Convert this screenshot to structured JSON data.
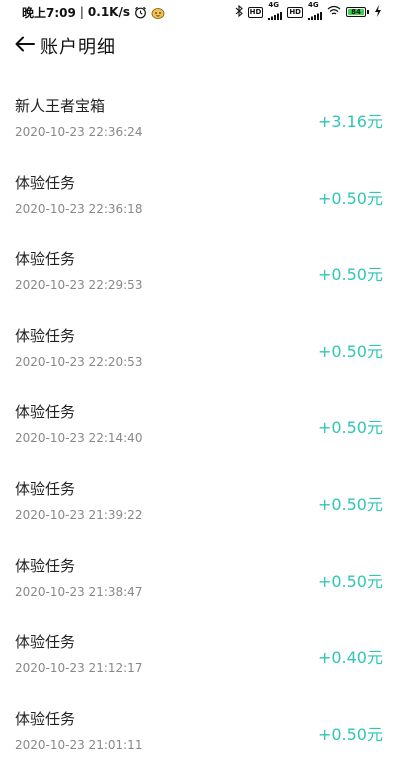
{
  "status_bar": {
    "time": "晚上7:09",
    "separator": "|",
    "speed": "0.1K/s",
    "hd1": "HD",
    "net1": "4G",
    "hd2": "HD",
    "net2": "4G",
    "battery": "84"
  },
  "header": {
    "title": "账户明细"
  },
  "records": [
    {
      "title": "新人王者宝箱",
      "time": "2020-10-23 22:36:24",
      "amount": "+3.16元"
    },
    {
      "title": "体验任务",
      "time": "2020-10-23 22:36:18",
      "amount": "+0.50元"
    },
    {
      "title": "体验任务",
      "time": "2020-10-23 22:29:53",
      "amount": "+0.50元"
    },
    {
      "title": "体验任务",
      "time": "2020-10-23 22:20:53",
      "amount": "+0.50元"
    },
    {
      "title": "体验任务",
      "time": "2020-10-23 22:14:40",
      "amount": "+0.50元"
    },
    {
      "title": "体验任务",
      "time": "2020-10-23 21:39:22",
      "amount": "+0.50元"
    },
    {
      "title": "体验任务",
      "time": "2020-10-23 21:38:47",
      "amount": "+0.50元"
    },
    {
      "title": "体验任务",
      "time": "2020-10-23 21:12:17",
      "amount": "+0.40元"
    },
    {
      "title": "体验任务",
      "time": "2020-10-23 21:01:11",
      "amount": "+0.50元"
    }
  ],
  "colors": {
    "amount": "#2fc6b8",
    "battery_fill": "#3ad14a"
  },
  "icons": {
    "alarm": "alarm-clock-icon",
    "app": "app-notification-icon",
    "bluetooth": "bluetooth-icon",
    "signal": "signal-icon",
    "wifi": "wifi-icon",
    "charging": "lightning-icon",
    "back": "arrow-left-icon"
  }
}
